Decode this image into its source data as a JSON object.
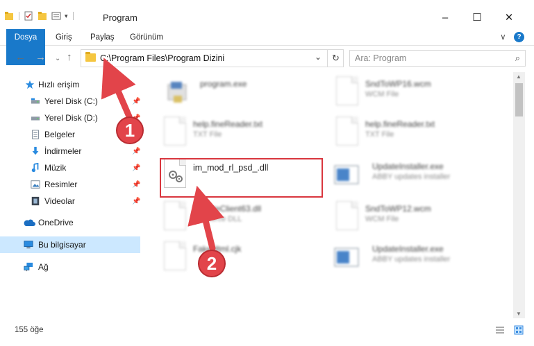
{
  "window": {
    "title": "Program",
    "minimize_glyph": "–",
    "maximize_glyph": "☐",
    "close_glyph": "✕"
  },
  "ribbon": {
    "tabs": [
      "Dosya",
      "Giriş",
      "Paylaş",
      "Görünüm"
    ],
    "expand_glyph": "∨",
    "help_glyph": "?"
  },
  "address": {
    "path": "C:\\Program Files\\Program Dizini",
    "dropdown_glyph": "⌄",
    "refresh_glyph": "↻"
  },
  "nav": {
    "back_glyph": "←",
    "forward_glyph": "→",
    "recent_glyph": "⌄",
    "up_glyph": "↑"
  },
  "search": {
    "placeholder": "Ara: Program",
    "icon": "search-icon",
    "icon_glyph": "⌕"
  },
  "sidebar": {
    "pin_glyph": "📌",
    "items": [
      {
        "label": "Hızlı erişim",
        "icon": "star-icon",
        "pinned": false
      },
      {
        "label": "Yerel Disk (C:)",
        "icon": "drive-icon",
        "pinned": true
      },
      {
        "label": "Yerel Disk (D:)",
        "icon": "drive-icon",
        "pinned": true
      },
      {
        "label": "Belgeler",
        "icon": "documents-icon",
        "pinned": true
      },
      {
        "label": "İndirmeler",
        "icon": "download-icon",
        "pinned": true
      },
      {
        "label": "Müzik",
        "icon": "music-icon",
        "pinned": true
      },
      {
        "label": "Resimler",
        "icon": "pictures-icon",
        "pinned": true
      },
      {
        "label": "Videolar",
        "icon": "videos-icon",
        "pinned": true
      },
      {
        "label": "OneDrive",
        "icon": "cloud-icon",
        "pinned": false
      },
      {
        "label": "Bu bilgisayar",
        "icon": "computer-icon",
        "pinned": false,
        "selected": true
      },
      {
        "label": "Ağ",
        "icon": "network-icon",
        "pinned": false
      }
    ]
  },
  "files": [
    {
      "name": "program.exe",
      "type": "",
      "icon": "exe-icon",
      "blurred": true
    },
    {
      "name": "SndToWP16.wcm",
      "type": "WCM File",
      "icon": "document-icon",
      "blurred": true
    },
    {
      "name": "help.fineReader.txt",
      "type": "TXT File",
      "icon": "document-icon",
      "blurred": true
    },
    {
      "name": "help.fineReader.txt",
      "type": "TXT File",
      "icon": "document-icon",
      "blurred": true
    },
    {
      "name": "im_mod_rl_psd_.dll",
      "type": "",
      "icon": "dll-gear-icon",
      "blurred": false,
      "highlighted": true
    },
    {
      "name": "UpdateInstaller.exe",
      "type": "ABBY updates installer",
      "icon": "installer-icon",
      "blurred": true
    },
    {
      "name": "UpdateClient63.dll",
      "type": "Resource DLL",
      "icon": "dll-gear-icon",
      "blurred": true
    },
    {
      "name": "SndToWP12.wcm",
      "type": "WCM File",
      "icon": "document-icon",
      "blurred": true
    },
    {
      "name": "FakeHtml.cjk",
      "type": "",
      "icon": "document-icon",
      "blurred": true
    },
    {
      "name": "UpdateInstaller.exe",
      "type": "ABBY updates installer",
      "icon": "installer-icon",
      "blurred": true
    }
  ],
  "scrollbar": {
    "up_glyph": "▲",
    "down_glyph": "▼"
  },
  "status": {
    "count_text": "155 öğe"
  },
  "callouts": [
    "1",
    "2"
  ],
  "colors": {
    "accent": "#1979ca",
    "highlight": "#d9363e",
    "selection": "#cce8ff",
    "callout": "#e2444a"
  }
}
